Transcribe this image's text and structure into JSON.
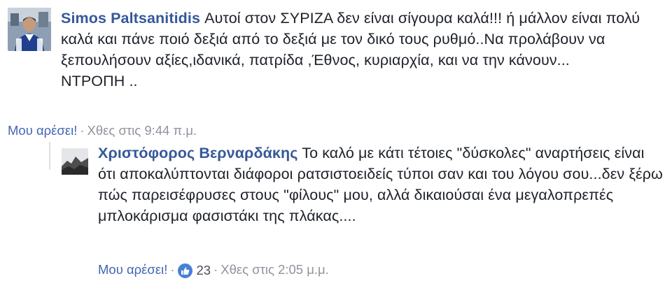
{
  "comment": {
    "author": "Simos Paltsanitidis",
    "text": "Αυτοί στον ΣΥΡΙΖΑ δεν είναι σίγουρα καλά!!! ή μάλλον είναι πολύ καλά και πάνε ποιό δεξιά από το δεξιά με τον δικό τους ρυθμό..Να προλάβουν να ξεπουλήσουν αξίες,ιδανικά, πατρίδα ,Έθνος, κυριαρχία, και να την κάνουν...",
    "text2": "ΝΤΡΟΠΗ ..",
    "like_label": "Μου αρέσει!",
    "separator": "·",
    "time": "Χθες στις 9:44 π.μ."
  },
  "reply": {
    "author": "Χριστόφορος Βερναρδάκης",
    "text": "Το καλό με κάτι τέτοιες \"δύσκολες\" αναρτήσεις είναι ότι αποκαλύπτονται διάφοροι ρατσιστοειδείς τύποι σαν και του λόγου σου...δεν ξέρω πώς παρεισέφρυσες στους \"φίλους\" μου, αλλά δικαιούσαι ένα μεγαλοπρεπές μπλοκάρισμα φασιστάκι της πλάκας....",
    "like_label": "Μου αρέσει!",
    "separator": "·",
    "reaction_count": "23",
    "time": "Χθες στις 2:05 μ.μ."
  },
  "icons": {
    "reaction": "thumbs-up-reaction-icon"
  },
  "colors": {
    "author": "#365899",
    "link": "#4267b2",
    "meta": "#90949c",
    "reaction": "#4a7fd6"
  }
}
